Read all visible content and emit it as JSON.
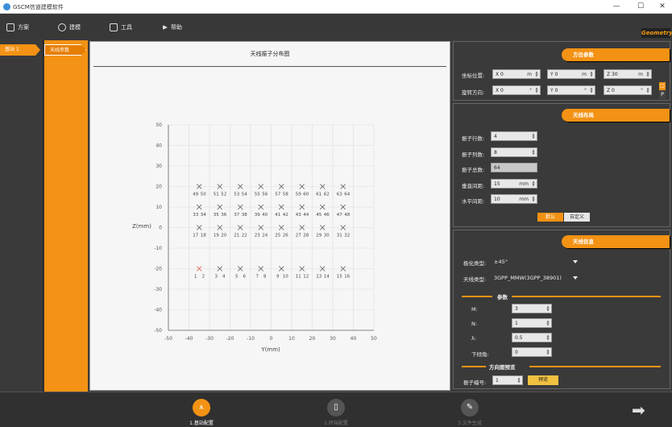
{
  "window": {
    "title": "GSCM信道建模软件",
    "minimize": "—",
    "maximize": "☐",
    "close": "✕"
  },
  "menu": [
    {
      "label": "方案",
      "icon": "document-icon"
    },
    {
      "label": "建模",
      "icon": "cube-icon"
    },
    {
      "label": "工具",
      "icon": "toolbox-icon"
    },
    {
      "label": "帮助",
      "icon": "send-icon"
    }
  ],
  "geometry_badge": "Geometry",
  "sidebar": {
    "station": "基站 1",
    "param": "天线参数"
  },
  "plot": {
    "title": "天线振子分布图"
  },
  "chart_data": {
    "type": "scatter",
    "xlabel": "Y(mm)",
    "ylabel": "Z(mm)",
    "xlim": [
      -50,
      50
    ],
    "ylim": [
      -50,
      50
    ],
    "xticks": [
      "-50",
      "-40",
      "-30",
      "-20",
      "-10",
      "0",
      "10",
      "20",
      "30",
      "40",
      "50"
    ],
    "yticks": [
      "50",
      "40",
      "30",
      "20",
      "10",
      "0",
      "-10",
      "-20",
      "-30",
      "-40",
      "-50"
    ],
    "grid": true,
    "x": [
      -35,
      -25,
      -15,
      -5,
      5,
      15,
      25,
      35
    ],
    "y": [
      -20,
      -10,
      0,
      10
    ],
    "markers": "x",
    "rows": [
      {
        "z": -20,
        "labels": [
          "1",
          "2",
          "3",
          "4",
          "5",
          "6",
          "7",
          "8",
          "9",
          "10",
          "11",
          "12",
          "13",
          "14",
          "15",
          "16"
        ],
        "first_color": "#e05a4a"
      },
      {
        "z": 0,
        "labels": [
          "17",
          "18",
          "19",
          "20",
          "21",
          "22",
          "23",
          "24",
          "25",
          "26",
          "27",
          "28",
          "29",
          "30",
          "31",
          "32"
        ]
      },
      {
        "z": 10,
        "labels": [
          "33",
          "34",
          "35",
          "36",
          "37",
          "38",
          "39",
          "40",
          "41",
          "42",
          "43",
          "44",
          "45",
          "46",
          "47",
          "48"
        ]
      },
      {
        "z": 20,
        "labels": [
          "49",
          "50",
          "51",
          "52",
          "53",
          "54",
          "55",
          "56",
          "57",
          "58",
          "59",
          "60",
          "61",
          "62",
          "63",
          "64"
        ]
      }
    ]
  },
  "position_panel": {
    "header": "方位参数",
    "coord_label": "坐标位置:",
    "rot_label": "旋转方向:",
    "coord": [
      {
        "axis": "X",
        "value": "0",
        "unit": "m"
      },
      {
        "axis": "Y",
        "value": "0",
        "unit": "m"
      },
      {
        "axis": "Z",
        "value": "30",
        "unit": "m"
      }
    ],
    "rot": [
      {
        "axis": "X",
        "value": "0",
        "unit": "°"
      },
      {
        "axis": "Y",
        "value": "0",
        "unit": "°"
      },
      {
        "axis": "Z",
        "value": "0",
        "unit": "°"
      }
    ],
    "side_btn_top": "□",
    "side_btn_bottom": "P"
  },
  "layout_panel": {
    "header": "天线布局",
    "rows_label": "振子行数:",
    "rows": "4",
    "cols_label": "振子列数:",
    "cols": "8",
    "total_label": "振子总数:",
    "total": "64",
    "vspace_label": "垂直间距:",
    "vspace": "15",
    "vunit": "mm",
    "hspace_label": "水平间距:",
    "hspace": "10",
    "hunit": "mm",
    "default_btn": "默认",
    "custom_btn": "自定义"
  },
  "info_panel": {
    "header": "天线信息",
    "pol_label": "极化类型:",
    "pol": "±45°",
    "type_label": "天线类型:",
    "type": "3GPP_MMW(3GPP_38901)",
    "params_title": "参数",
    "m_label": "M:",
    "m": "3",
    "n_label": "N:",
    "n": "1",
    "lambda_label": "λ:",
    "lambda": "0.5",
    "tilt_label": "下倾角:",
    "tilt": "0",
    "pattern_title": "方向图预览",
    "elem_label": "振子编号:",
    "elem": "1",
    "preview_btn": "预览"
  },
  "footer": {
    "steps": [
      {
        "label": "1.基站配置",
        "active": true
      },
      {
        "label": "2.终端配置",
        "active": false
      },
      {
        "label": "3.文件生成",
        "active": false
      }
    ],
    "next": "➡"
  }
}
